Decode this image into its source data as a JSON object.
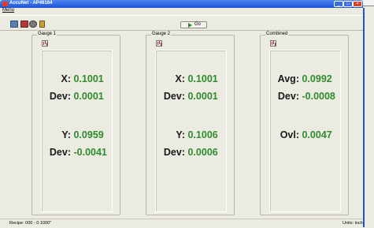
{
  "window": {
    "title": "AccuNet - AP46164"
  },
  "menu": {
    "items": [
      "Menu"
    ]
  },
  "toolbar": {
    "go_label": "Go",
    "icons": [
      "table-icon",
      "report-icon",
      "settings-icon",
      "door-icon"
    ]
  },
  "gauge1": {
    "title": "Gauge 1",
    "x_label": "X:",
    "x_value": "0.1001",
    "x_dev_label": "Dev:",
    "x_dev_value": "0.0001",
    "y_label": "Y:",
    "y_value": "0.0959",
    "y_dev_label": "Dev:",
    "y_dev_value": "-0.0041"
  },
  "gauge2": {
    "title": "Gauge 2",
    "x_label": "X:",
    "x_value": "0.1001",
    "x_dev_label": "Dev:",
    "x_dev_value": "0.0001",
    "y_label": "Y:",
    "y_value": "0.1006",
    "y_dev_label": "Dev:",
    "y_dev_value": "0.0006"
  },
  "combined": {
    "title": "Combined",
    "avg_label": "Avg:",
    "avg_value": "0.0992",
    "dev_label": "Dev:",
    "dev_value": "-0.0008",
    "ovl_label": "Ovl:",
    "ovl_value": "0.0047"
  },
  "status": {
    "left": "Recipe: 000 - 0.1000\"",
    "right": "Units: inch"
  },
  "colors": {
    "value_green": "#2e8b2e",
    "titlebar_blue": "#1d53d6",
    "window_bg": "#ecebe1"
  }
}
